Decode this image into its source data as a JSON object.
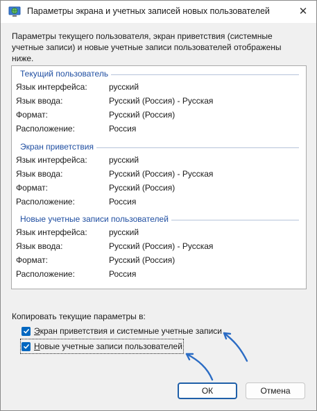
{
  "window": {
    "title": "Параметры экрана и учетных записей новых пользователей",
    "close_glyph": "✕"
  },
  "description": "Параметры текущего пользователя, экран приветствия (системные учетные записи) и новые учетные записи пользователей отображены ниже.",
  "sections": [
    {
      "title": "Текущий пользователь",
      "rows": [
        {
          "label": "Язык интерфейса:",
          "value": "русский"
        },
        {
          "label": "Язык ввода:",
          "value": "Русский (Россия) - Русская"
        },
        {
          "label": "Формат:",
          "value": "Русский (Россия)"
        },
        {
          "label": "Расположение:",
          "value": "Россия"
        }
      ]
    },
    {
      "title": "Экран приветствия",
      "rows": [
        {
          "label": "Язык интерфейса:",
          "value": "русский"
        },
        {
          "label": "Язык ввода:",
          "value": "Русский (Россия) - Русская"
        },
        {
          "label": "Формат:",
          "value": "Русский (Россия)"
        },
        {
          "label": "Расположение:",
          "value": "Россия"
        }
      ]
    },
    {
      "title": "Новые учетные записи пользователей",
      "rows": [
        {
          "label": "Язык интерфейса:",
          "value": "русский"
        },
        {
          "label": "Язык ввода:",
          "value": "Русский (Россия) - Русская"
        },
        {
          "label": "Формат:",
          "value": "Русский (Россия)"
        },
        {
          "label": "Расположение:",
          "value": "Россия"
        }
      ]
    }
  ],
  "copy": {
    "label": "Копировать текущие параметры в:",
    "welcome_first": "Э",
    "welcome_rest": "кран приветствия и системные учетные записи",
    "welcome_checked": true,
    "new_users_first": "Н",
    "new_users_rest": "овые учетные записи пользователей",
    "new_users_checked": true
  },
  "buttons": {
    "ok": "ОК",
    "cancel": "Отмена"
  },
  "colors": {
    "accent": "#0067c0",
    "section_title": "#1f4ea1",
    "annotation_arrow": "#2b6cc4"
  },
  "icons": {
    "title": "globe-monitor-icon",
    "close": "close-icon",
    "checkbox": "checkmark-icon"
  }
}
